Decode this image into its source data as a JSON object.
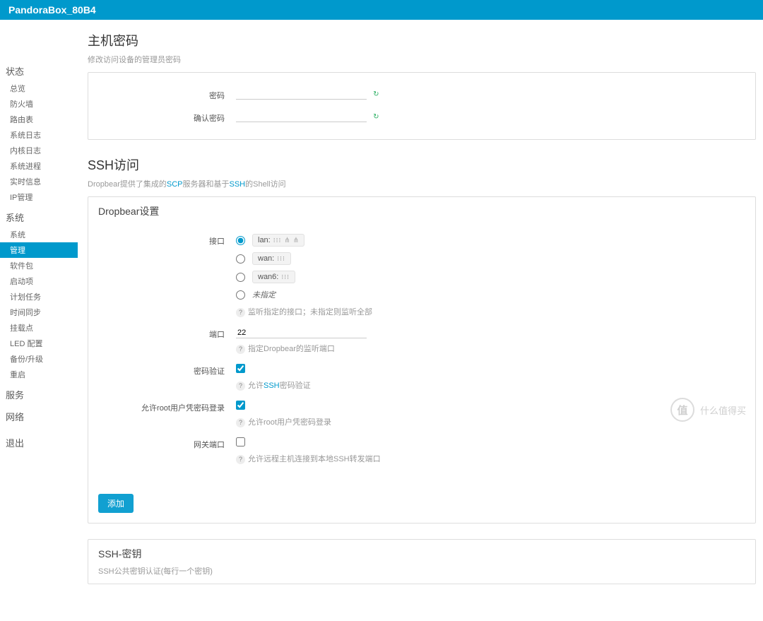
{
  "header": {
    "title": "PandoraBox_80B4"
  },
  "sidebar": {
    "cat_status": "状态",
    "status_items": [
      "总览",
      "防火墙",
      "路由表",
      "系统日志",
      "内核日志",
      "系统进程",
      "实时信息",
      "IP管理"
    ],
    "cat_system": "系统",
    "system_items": [
      "系统",
      "管理",
      "软件包",
      "启动项",
      "计划任务",
      "时间同步",
      "挂载点",
      "LED 配置",
      "备份/升级",
      "重启"
    ],
    "cat_service": "服务",
    "cat_network": "网络",
    "cat_logout": "退出"
  },
  "host_pw": {
    "title": "主机密码",
    "subtitle": "修改访问设备的管理员密码",
    "label_pw": "密码",
    "label_confirm": "确认密码"
  },
  "ssh": {
    "title": "SSH访问",
    "subtitle_pre": "Dropbear提供了集成的",
    "subtitle_scp": "SCP",
    "subtitle_mid": "服务器和基于",
    "subtitle_ssh": "SSH",
    "subtitle_post": "的Shell访问",
    "panel_title": "Dropbear设置",
    "label_interface": "接口",
    "iface": {
      "lan": "lan:",
      "wan": "wan:",
      "wan6": "wan6:",
      "none": "未指定",
      "hint": "监听指定的接口；未指定则监听全部"
    },
    "label_port": "端口",
    "port_value": "22",
    "port_hint": "指定Dropbear的监听端口",
    "label_pw_auth": "密码验证",
    "pw_auth_hint_pre": "允许",
    "pw_auth_hint_link": "SSH",
    "pw_auth_hint_post": "密码验证",
    "label_root_pw": "允许root用户凭密码登录",
    "root_pw_hint": "允许root用户凭密码登录",
    "label_gateway": "网关端口",
    "gateway_hint": "允许远程主机连接到本地SSH转发端口",
    "btn_add": "添加"
  },
  "sshkey": {
    "title": "SSH-密钥",
    "subtitle": "SSH公共密钥认证(每行一个密钥)"
  },
  "watermark": {
    "symbol": "值",
    "text": "什么值得买"
  }
}
